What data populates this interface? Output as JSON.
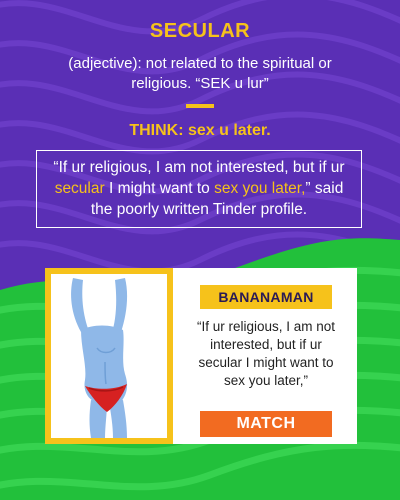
{
  "word": "SECULAR",
  "definition": "(adjective): not related to the spiritual or religious. “SEK u lur”",
  "think": "THINK: sex u later.",
  "quote": {
    "part1": "“If ur religious, I am not interested, but if ur ",
    "highlight1": "secular",
    "part2": " I might want to ",
    "highlight2": "sex you later,",
    "part3": "” said the poorly written Tinder profile."
  },
  "profile": {
    "name": "BANANAMAN",
    "quote": "“If ur religious, I am not interested, but if ur secular I might want to sex you later,”",
    "match_label": "MATCH"
  },
  "colors": {
    "purple_bg": "#5a2fb5",
    "green_bg": "#22c03b",
    "accent_yellow": "#f6c21b",
    "match_orange": "#f26b21"
  }
}
